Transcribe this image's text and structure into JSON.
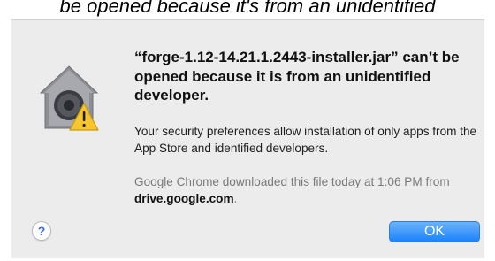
{
  "caption": {
    "text": "be opened because it's from an unidentified"
  },
  "dialog": {
    "headline": "“forge-1.12-14.21.1.2443-installer.jar” can’t be opened because it is from an unidentified developer.",
    "message": "Your security preferences allow installation of only apps from the App Store and identified developers.",
    "source_prefix": "Google Chrome downloaded this file today at 1:06 PM from ",
    "source_domain": "drive.google.com",
    "source_suffix": ".",
    "icon": "gatekeeper-warning-icon",
    "help_label": "?",
    "ok_label": "OK",
    "accent_color": "#1a82fb",
    "warning_color": "#f7c62f"
  }
}
